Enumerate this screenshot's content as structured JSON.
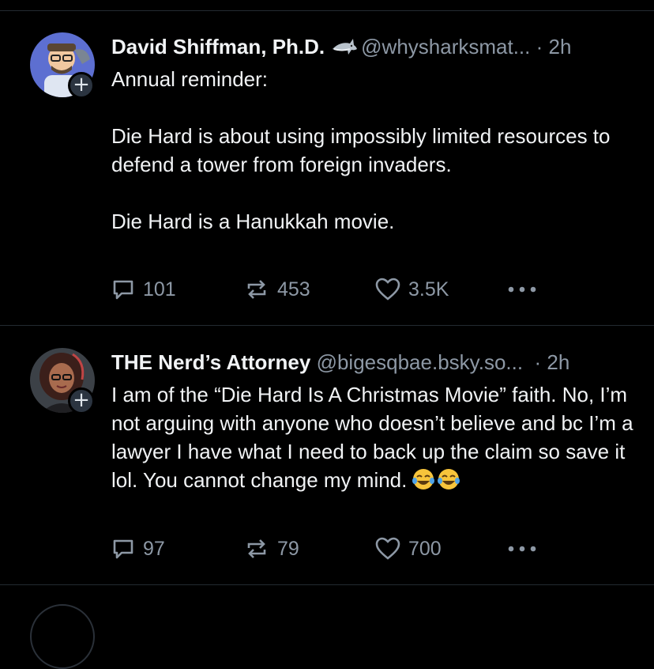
{
  "posts": [
    {
      "display_name": "David Shiffman, Ph.D.",
      "handle": "@whysharksmat...",
      "timestamp": "· 2h",
      "name_icon": "shark-icon",
      "text": "Annual reminder:\n\nDie Hard is about using impossibly limited resources to defend a tower from foreign invaders.\n\nDie Hard is a Hanukkah movie.",
      "replies": "101",
      "reposts": "453",
      "likes": "3.5K",
      "follow_symbol": "+"
    },
    {
      "display_name": "THE Nerd’s Attorney",
      "handle": "@bigesqbae.bsky.so...",
      "timestamp": "· 2h",
      "text": "I am of the “Die Hard Is A Christmas Movie” faith. No, I’m not arguing with anyone who doesn’t believe and bc I’m a lawyer I have what I need to back up the claim so save it lol. You cannot change my mind.",
      "trailing_icons": [
        "tears-of-joy-emoji-icon",
        "tears-of-joy-emoji-icon"
      ],
      "replies": "97",
      "reposts": "79",
      "likes": "700",
      "follow_symbol": "+"
    }
  ],
  "colors": {
    "background": "#000000",
    "text": "#f1f3f5",
    "muted": "#8d98a5",
    "divider": "#232a31"
  }
}
